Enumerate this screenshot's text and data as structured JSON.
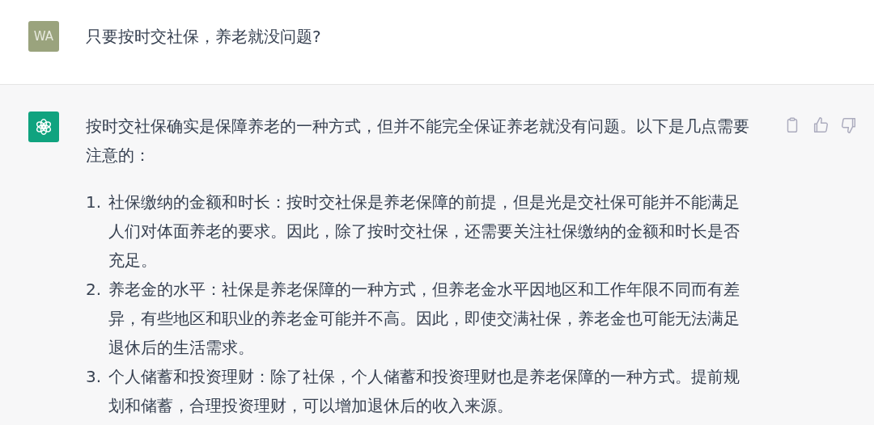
{
  "messages": [
    {
      "kind": "user",
      "avatar": "WA",
      "color": "#9aa37d",
      "paragraphs": [
        "只要按时交社保，养老就没问题?"
      ]
    },
    {
      "kind": "assistant",
      "color": "#10a37f",
      "paragraphs": [
        "按时交社保确实是保障养老的一种方式，但并不能完全保证养老就没有问题。以下是几点需要注意的："
      ],
      "list": [
        "社保缴纳的金额和时长：按时交社保是养老保障的前提，但是光是交社保可能并不能满足人们对体面养老的要求。因此，除了按时交社保，还需要关注社保缴纳的金额和时长是否充足。",
        "养老金的水平：社保是养老保障的一种方式，但养老金水平因地区和工作年限不同而有差异，有些地区和职业的养老金可能并不高。因此，即使交满社保，养老金也可能无法满足退休后的生活需求。",
        "个人储蓄和投资理财：除了社保，个人储蓄和投资理财也是养老保障的一种方式。提前规划和储蓄，合理投资理财，可以增加退休后的收入来源。"
      ],
      "list_numbers": [
        "1.",
        "2.",
        "3."
      ]
    }
  ]
}
